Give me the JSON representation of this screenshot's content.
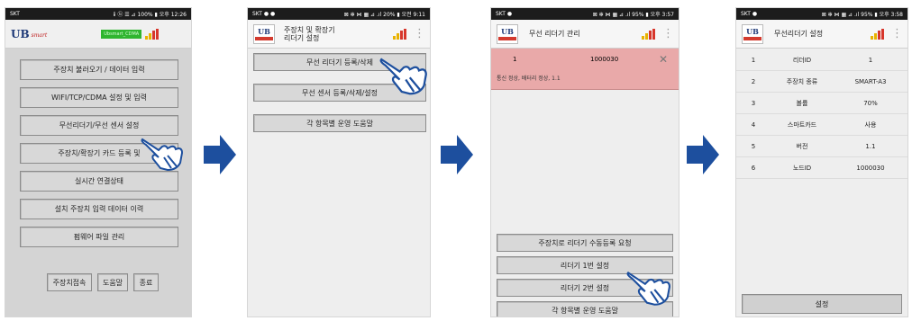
{
  "phone1": {
    "status": {
      "left": "SKT",
      "right": "ⅱ ⓑ ☰ ⊿ 100% ▮ 오후 12:26"
    },
    "logo": "UB",
    "logo_sub": "smart",
    "header_badge": "Ubsmart_CDMA",
    "menu": [
      "주장치 불러오기 / 데이터 입력",
      "WIFI/TCP/CDMA 설정 및 입력",
      "무선리더기/무선 센서 설정",
      "주장치/확장기 카드 등록 및",
      "실시간 연결상태",
      "설치 주장치 입력 데이터 이력",
      "펌웨어 파일 관리"
    ],
    "bottom_buttons": [
      "주장치접속",
      "도움말",
      "종료"
    ]
  },
  "phone2": {
    "status": {
      "left": "SKT ● ●",
      "right": "⊠ ✻ ⋈ ▦ ⊿ .ıl 20% ▮ 오전 9:11"
    },
    "title_line1": "주장치 및 확장기",
    "title_line2": "리더기 설정",
    "menu": [
      "무선 리더기 등록/삭제",
      "무선 센서 등록/삭제/설정",
      "각 항목별 운영 도움말"
    ]
  },
  "phone3": {
    "status": {
      "left": "SKT ●",
      "right": "⊠ ✻ ⋈ ▦ ⊿ .ıl 95% ▮ 오후 3:57"
    },
    "title": "무선 리더기 관리",
    "item": {
      "index": "1",
      "code": "1000030",
      "detail": "통신 정상, 배터리 정상, 1.1"
    },
    "close": "✕",
    "menu": [
      "주장치로 리더기 수동등록 요청",
      "리더기 1번 설정",
      "리더기 2번 설정",
      "각 항목별 운영 도움말"
    ]
  },
  "phone4": {
    "status": {
      "left": "SKT ●",
      "right": "⊠ ✻ ⋈ ▦ ⊿ .ıl 95% ▮ 오후 3:58"
    },
    "title": "무선리더기 설정",
    "rows": [
      [
        "1",
        "리더ID",
        "1"
      ],
      [
        "2",
        "주장치 종류",
        "SMART-A3"
      ],
      [
        "3",
        "볼륨",
        "70%"
      ],
      [
        "4",
        "스마트카드",
        "사용"
      ],
      [
        "5",
        "버전",
        "1.1"
      ],
      [
        "6",
        "노드ID",
        "1000030"
      ]
    ],
    "footer_button": "설정"
  },
  "colors": {
    "arrow": "#1d4f9e",
    "selected_item": "#e9a9a9",
    "badge_green": "#2fb52f"
  }
}
